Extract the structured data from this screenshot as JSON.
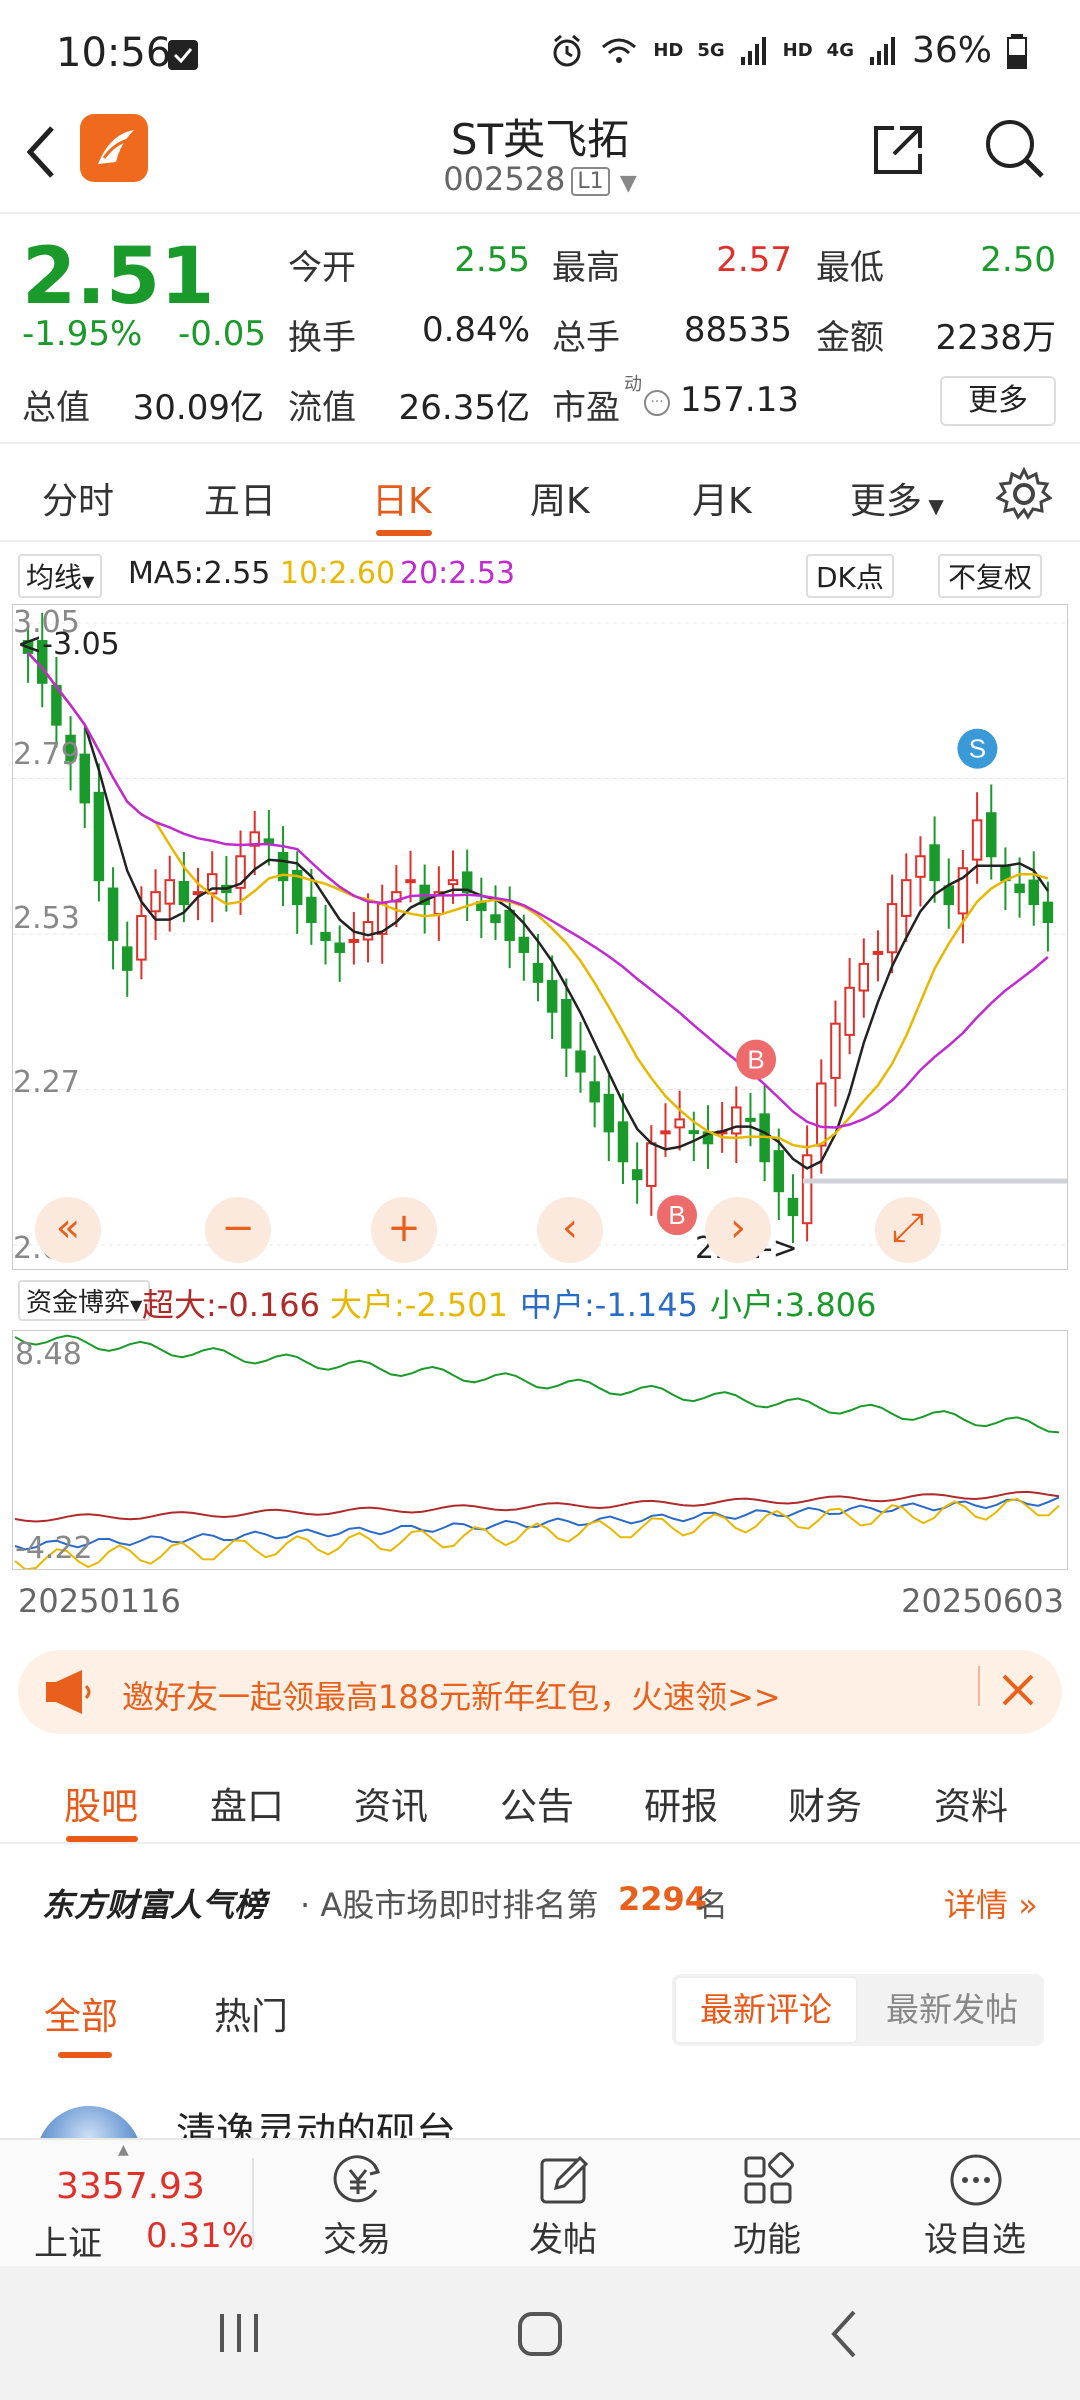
{
  "status_bar": {
    "time": "10:56",
    "hd1": "HD",
    "net1": "5G",
    "hd2": "HD",
    "net2": "4G",
    "battery": "36%"
  },
  "header": {
    "title": "ST英飞拓",
    "code": "002528",
    "board": "L1"
  },
  "quote": {
    "price": "2.51",
    "change_pct": "-1.95%",
    "change": "-0.05",
    "open_label": "今开",
    "open": "2.55",
    "high_label": "最高",
    "high": "2.57",
    "low_label": "最低",
    "low": "2.50",
    "turnover_label": "换手",
    "turnover": "0.84%",
    "volume_label": "总手",
    "volume": "88535",
    "amount_label": "金额",
    "amount": "2238万",
    "mktcap_label": "总值",
    "mktcap": "30.09亿",
    "float_label": "流值",
    "float": "26.35亿",
    "pe_label": "市盈",
    "pe_sup": "动",
    "pe": "157.13",
    "more_label": "更多"
  },
  "kline_tabs": [
    "分时",
    "五日",
    "日K",
    "周K",
    "月K",
    "更多"
  ],
  "ma": {
    "selector": "均线",
    "ma5": "MA5:2.55",
    "ma10": "10:2.60",
    "ma20": "20:2.53",
    "dk": "DK点",
    "fq": "不复权"
  },
  "chart_data": {
    "type": "candlestick",
    "y_ticks": [
      "3.05",
      "2.79",
      "2.53",
      "2.27",
      "2.01"
    ],
    "high_marker": "<-3.05",
    "low_marker": "2.01->",
    "signals": [
      "B",
      "B",
      "S"
    ],
    "colors": {
      "up": "#e0302a",
      "down": "#1a9a2a",
      "ma5": "#222222",
      "ma10": "#e8b800",
      "ma20": "#c02ad0"
    }
  },
  "chart_controls": [
    "«",
    "−",
    "+",
    "‹",
    "›",
    "⤢"
  ],
  "flow": {
    "selector": "资金博弈",
    "chaoda": "超大:-0.166",
    "dahu": "大户:-2.501",
    "zhonghu": "中户:-1.145",
    "xiaohu": "小户:3.806",
    "top": "8.48",
    "bottom": "-4.22"
  },
  "dates": {
    "start": "20250116",
    "end": "20250603"
  },
  "banner": {
    "text": "邀好友一起领最高188元新年红包，火速领>>"
  },
  "section_tabs": [
    "股吧",
    "盘口",
    "资讯",
    "公告",
    "研报",
    "财务",
    "资料"
  ],
  "rank": {
    "brand": "东方财富人气榜",
    "prefix": "· A股市场即时排名第",
    "rank": "2294",
    "suffix": "名",
    "detail": "详情"
  },
  "feed_tabs": {
    "all": "全部",
    "hot": "热门",
    "latest_comment": "最新评论",
    "latest_post": "最新发帖"
  },
  "post_preview": {
    "author": "清逸灵动的砚台"
  },
  "index": {
    "value": "3357.93",
    "name": "上证",
    "pct": "0.31%"
  },
  "bottom_nav": [
    "交易",
    "发帖",
    "功能",
    "设自选"
  ]
}
